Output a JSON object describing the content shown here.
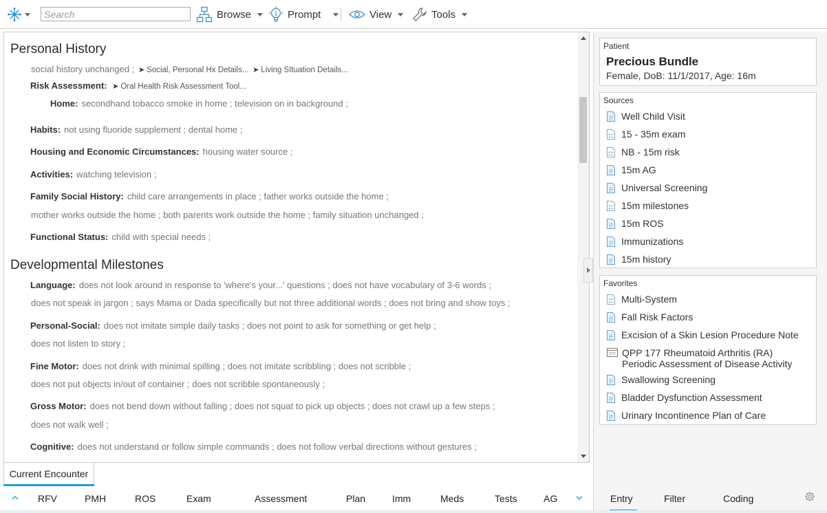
{
  "toolbar": {
    "search_placeholder": "Search",
    "browse": "Browse",
    "prompt": "Prompt",
    "view": "View",
    "tools": "Tools"
  },
  "personal_history": {
    "title": "Personal History",
    "intro_text": "social history unchanged ;",
    "intro_link1": "Social, Personal Hx Details...",
    "intro_link2": "Living SItuation Details...",
    "risk_label": "Risk Assessment:",
    "risk_link": "Oral Health Risk Assessment Tool...",
    "home_label": "Home:",
    "home_value": "secondhand tobacco smoke in home ;  television on in background ;",
    "habits_label": "Habits:",
    "habits_value": "not using fluoride supplement ;  dental home ;",
    "housing_label": "Housing and Economic Circumstances:",
    "housing_value": "housing water source ;",
    "activities_label": "Activities:",
    "activities_value": "watching television ;",
    "family_label": "Family Social History:",
    "family_value1": "child care arrangements in place ;  father works outside the home ;",
    "family_value2": "mother works outside the home ;  both parents work outside the home ;  family situation unchanged ;",
    "functional_label": "Functional Status:",
    "functional_value": "child with special needs ;"
  },
  "dev_milestones": {
    "title": "Developmental Milestones",
    "language_label": "Language:",
    "language_value1": "does not look around in response to 'where's your...' questions ;  does not have vocabulary of 3-6 words ;",
    "language_value2": "does not speak in jargon ;  says Mama or Dada specifically but not three additional words ;  does not bring and show toys ;",
    "personal_label": "Personal-Social:",
    "personal_value1": "does not imitate simple daily tasks ;  does not point to ask for something or get help ;",
    "personal_value2": "does not listen to story ;",
    "fine_label": "Fine Motor:",
    "fine_value1": "does not drink with minimal spilling ;  does not imitate scribbling ;  does not scribble ;",
    "fine_value2": "does not put objects in/out of container ;  does not scribble spontaneously ;",
    "gross_label": "Gross Motor:",
    "gross_value1": "does not bend down without falling ;  does not squat to pick up objects ;  does not crawl up a few steps ;",
    "gross_value2": "does not walk well ;",
    "cognitive_label": "Cognitive:",
    "cognitive_value": "does not understand or follow simple commands ;  does not follow verbal directions without gestures ;"
  },
  "bottom": {
    "current_tab": "Current Encounter",
    "nav": [
      "RFV",
      "PMH",
      "ROS",
      "Exam",
      "Assessment",
      "Plan",
      "Imm",
      "Meds",
      "Tests",
      "AG"
    ]
  },
  "sidebar": {
    "patient_title": "Patient",
    "patient_name": "Precious Bundle",
    "patient_info": "Female, DoB: 11/1/2017, Age: 16m",
    "sources_title": "Sources",
    "sources": [
      "Well Child Visit",
      "15 - 35m exam",
      "NB - 15m risk",
      "15m AG",
      "Universal Screening",
      "15m milestones",
      "15m ROS",
      "Immunizations",
      "15m history"
    ],
    "favorites_title": "Favorites",
    "favorites": [
      "Multi-System",
      "Fall Risk Factors",
      "Excision of a Skin Lesion Procedure Note",
      "QPP 177 Rheumatoid Arthritis (RA)",
      "Periodic Assessment of Disease Activity",
      "Swallowing Screening",
      "Bladder Dysfunction Assessment",
      "Urinary Incontinence Plan of Care"
    ],
    "tabs": [
      "Entry",
      "Filter",
      "Coding"
    ]
  },
  "colors": {
    "accent": "#1aa0e0",
    "icon_blue": "#3a8fd0"
  }
}
